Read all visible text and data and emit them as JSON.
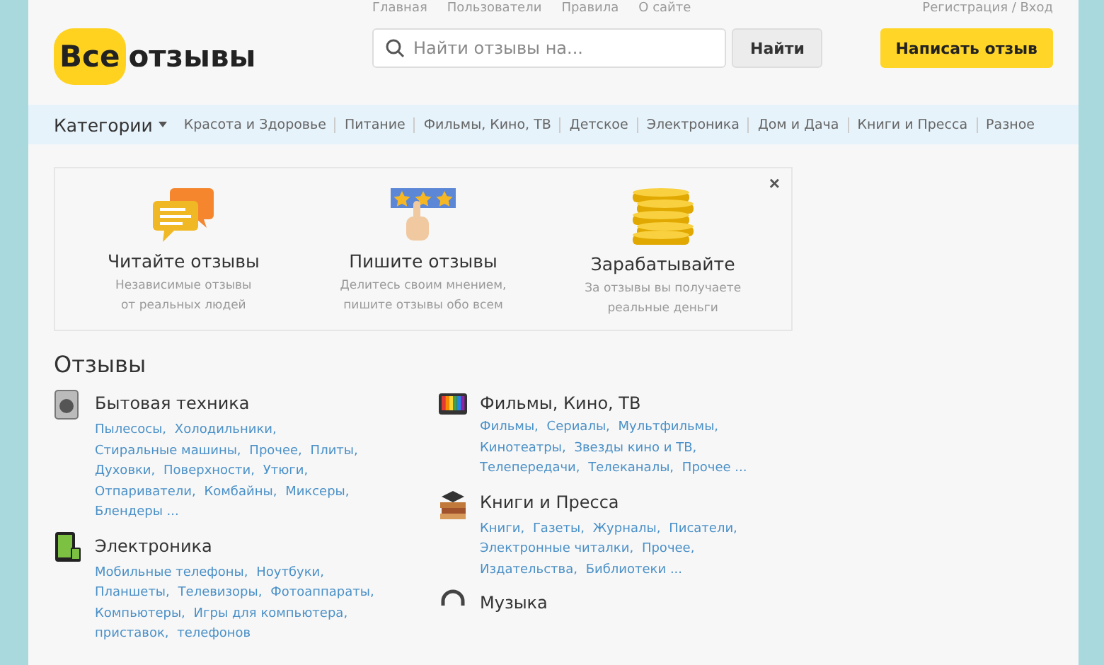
{
  "top_links": [
    "Главная",
    "Пользователи",
    "Правила",
    "О сайте"
  ],
  "auth_link": "Регистрация / Вход",
  "logo": {
    "badge": "Все",
    "text": "отзывы"
  },
  "search": {
    "placeholder": "Найти отзывы на...",
    "button": "Найти"
  },
  "write_button": "Написать отзыв",
  "nav": {
    "categories": "Категории",
    "items": [
      "Красота и Здоровье",
      "Питание",
      "Фильмы, Кино, ТВ",
      "Детское",
      "Электроника",
      "Дом и Дача",
      "Книги и Пресса",
      "Разное"
    ]
  },
  "promo": {
    "close": "×",
    "items": [
      {
        "kind": "chat",
        "title": "Читайте отзывы",
        "text": [
          "Независимые отзывы",
          "от реальных людей"
        ]
      },
      {
        "kind": "stars",
        "title": "Пишите отзывы",
        "text": [
          "Делитесь своим мнением,",
          "пишите отзывы обо всем"
        ]
      },
      {
        "kind": "coins",
        "title": "Зарабатывайте",
        "text": [
          "За отзывы вы получаете",
          "реальные деньги"
        ]
      }
    ]
  },
  "reviews": {
    "heading": "Отзывы",
    "columns": [
      [
        {
          "kind": "appliance",
          "title": "Бытовая техника",
          "links": [
            "Пылесосы,",
            "Холодильники,",
            "Стиральные машины,",
            "Прочее,",
            "Плиты,",
            "Духовки,",
            "Поверхности,",
            "Утюги,",
            "Отпариватели,",
            "Комбайны,",
            "Миксеры,",
            "Блендеры ..."
          ]
        },
        {
          "kind": "tablet",
          "title": "Электроника",
          "links": [
            "Мобильные телефоны,",
            "Ноутбуки,",
            "Планшеты,",
            "Телевизоры,",
            "Фотоаппараты,",
            "Компьютеры,",
            "Игры для компьютера,",
            "приставок,",
            "телефонов"
          ]
        }
      ],
      [
        {
          "kind": "tv",
          "title": "Фильмы, Кино, ТВ",
          "links": [
            "Фильмы,",
            "Сериалы,",
            "Мультфильмы,",
            "Кинотеатры,",
            "Звезды кино и ТВ,",
            "Телепередачи,",
            "Телеканалы,",
            "Прочее ..."
          ]
        },
        {
          "kind": "books",
          "title": "Книги и Пресса",
          "links": [
            "Книги,",
            "Газеты,",
            "Журналы,",
            "Писатели,",
            "Электронные читалки,",
            "Прочее,",
            "Издательства,",
            "Библиотеки ..."
          ]
        },
        {
          "kind": "headphones",
          "title": "Музыка"
        }
      ]
    ]
  }
}
